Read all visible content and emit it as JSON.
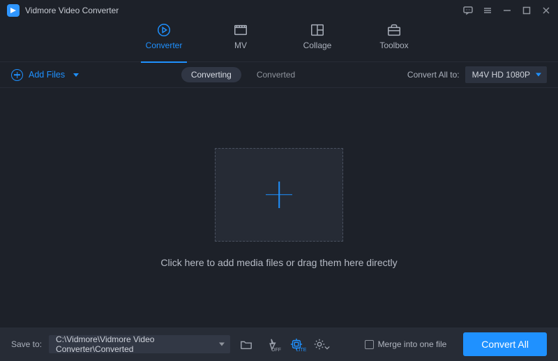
{
  "app": {
    "title": "Vidmore Video Converter"
  },
  "tabs": [
    {
      "label": "Converter",
      "active": true
    },
    {
      "label": "MV",
      "active": false
    },
    {
      "label": "Collage",
      "active": false
    },
    {
      "label": "Toolbox",
      "active": false
    }
  ],
  "toolbar": {
    "add_files_label": "Add Files",
    "segments": {
      "converting": "Converting",
      "converted": "Converted",
      "active": "converting"
    },
    "convert_all_to_label": "Convert All to:",
    "format_selected": "M4V HD 1080P"
  },
  "dropzone": {
    "hint": "Click here to add media files or drag them here directly"
  },
  "bottombar": {
    "save_to_label": "Save to:",
    "save_path": "C:\\Vidmore\\Vidmore Video Converter\\Converted",
    "merge_label": "Merge into one file",
    "hw_off_label": "OFF",
    "hw_lite_label": "LITE",
    "convert_button": "Convert All"
  }
}
